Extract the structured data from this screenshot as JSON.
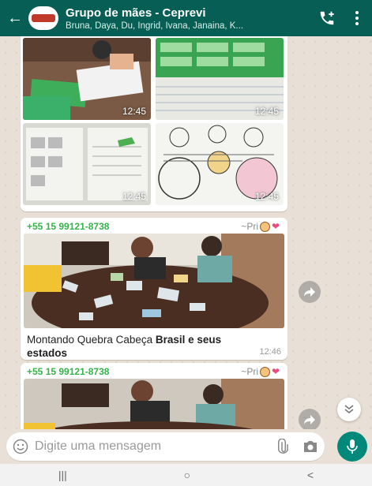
{
  "header": {
    "back_icon": "arrow-left-icon",
    "group_name": "Grupo de mães - Ceprevi",
    "participants": "Bruna, Daya, Du, Ingrid, Ivana, Janaina, K...",
    "add_call_icon": "call-add-icon",
    "menu_icon": "more-vert-icon",
    "bg": "#075e54"
  },
  "messages": [
    {
      "type": "image-grid",
      "sender": "+55 15 99121-8738",
      "tiles": [
        {
          "desc": "child-activity-photo",
          "time": "12:45"
        },
        {
          "desc": "green-worksheet-photo",
          "time": "12:45"
        },
        {
          "desc": "worksheet-photo",
          "time": "12:45"
        },
        {
          "desc": "coloring-sheet-photo",
          "time": "12:45"
        }
      ]
    },
    {
      "type": "image-caption",
      "sender": "+55 15 99121-8738",
      "pushname": "~Pri",
      "caption_plain": "Montando Quebra Cabeça ",
      "caption_bold": "Brasil e seus estados",
      "time": "12:46"
    },
    {
      "type": "image",
      "sender": "+55 15 99121-8738",
      "pushname": "~Pri"
    }
  ],
  "input": {
    "placeholder": "Digite uma mensagem",
    "emoji_icon": "emoji-icon",
    "attach_icon": "paperclip-icon",
    "camera_icon": "camera-icon",
    "mic_icon": "mic-icon",
    "accent": "#00897b"
  },
  "nav": {
    "recents": "|||",
    "home": "○",
    "back": "<"
  }
}
